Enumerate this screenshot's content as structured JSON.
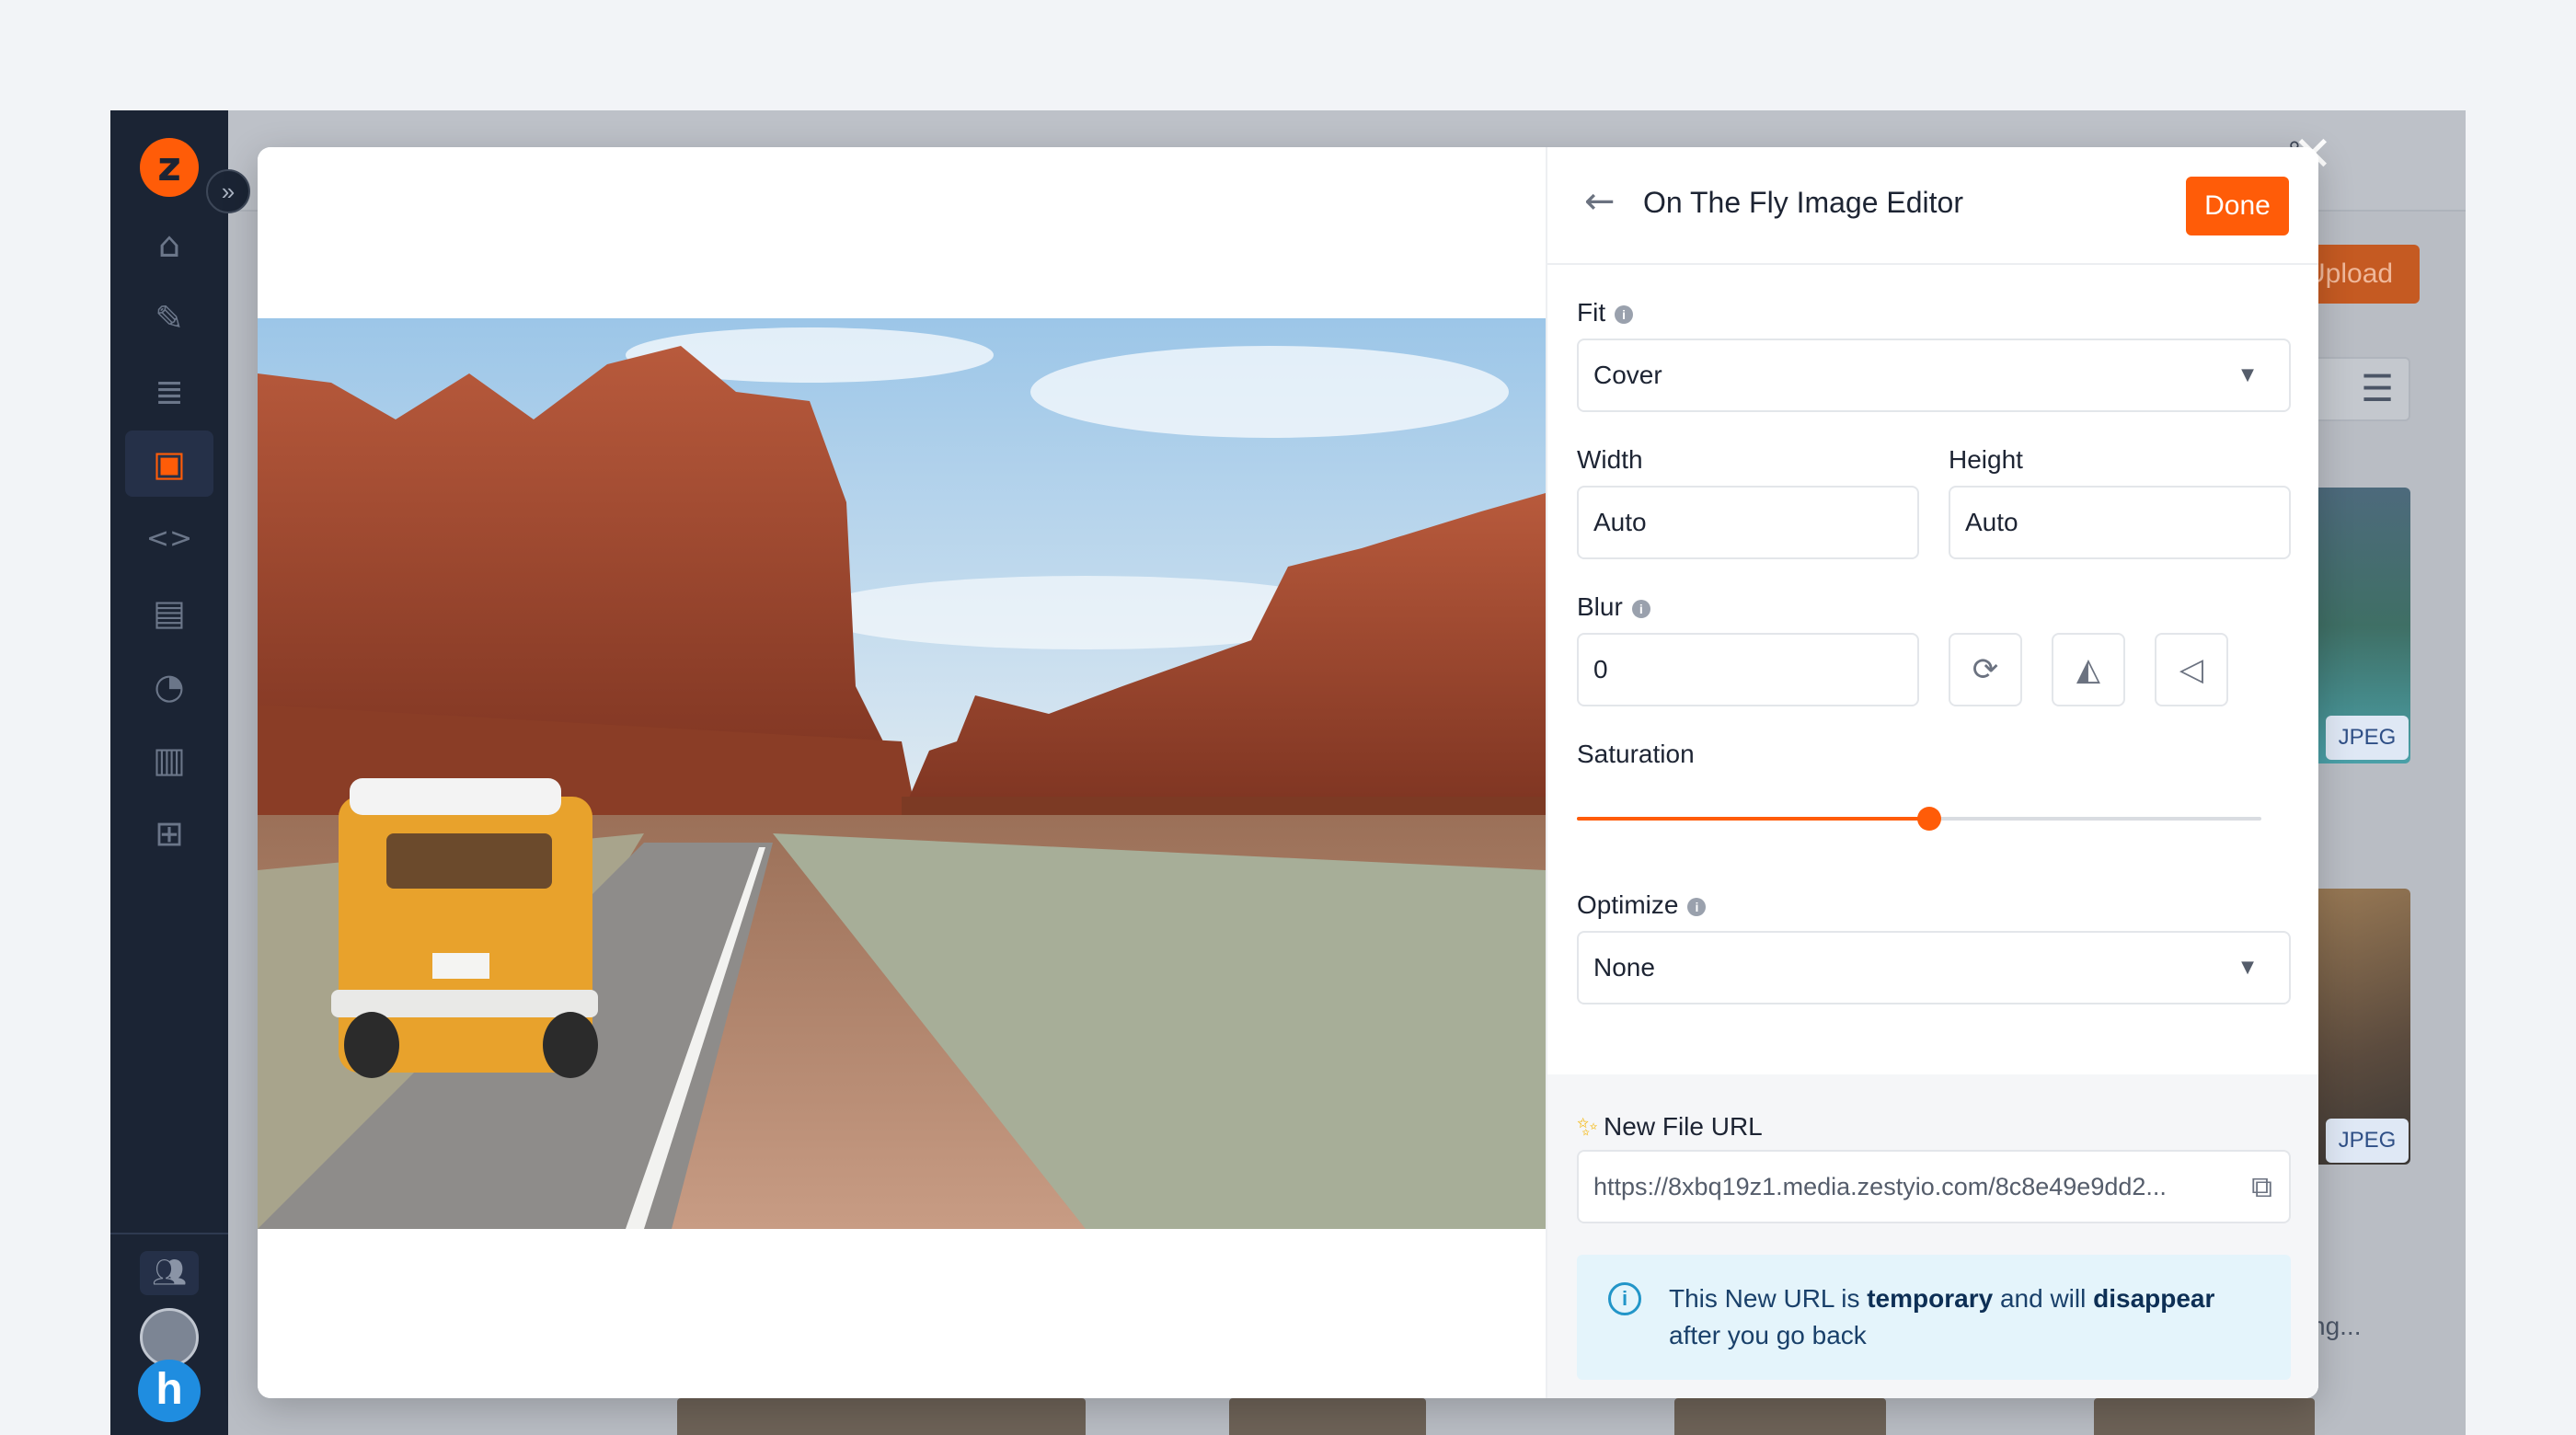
{
  "sidebar": {
    "logo_letter": "z",
    "nav": [
      "home-icon",
      "edit-icon",
      "database-icon",
      "media-icon",
      "code-icon",
      "reports-icon",
      "analytics-icon",
      "bar-chart-icon",
      "add-icon"
    ],
    "active_item": "media-icon"
  },
  "background": {
    "upload_label": "Upload",
    "jpeg_badge_1": "JPEG",
    "jpeg_badge_2": "JPEG",
    "truncated_filename": "ng..."
  },
  "editor": {
    "title": "On The Fly Image Editor",
    "done_label": "Done",
    "fit": {
      "label": "Fit",
      "value": "Cover"
    },
    "width": {
      "label": "Width",
      "value": "Auto"
    },
    "height": {
      "label": "Height",
      "value": "Auto"
    },
    "blur": {
      "label": "Blur",
      "value": "0"
    },
    "saturation": {
      "label": "Saturation",
      "level_fraction": 0.515
    },
    "optimize": {
      "label": "Optimize",
      "value": "None"
    },
    "new_url": {
      "label": "New File URL",
      "value": "https://8xbq19z1.media.zestyio.com/8c8e49e9dd2..."
    },
    "notice": {
      "part1": "This New URL is ",
      "bold1": "temporary",
      "part2": " and will ",
      "bold2": "disappear",
      "part3": " after you go back"
    }
  },
  "colors": {
    "accent": "#ff5c08",
    "sidebar_bg": "#1b2434",
    "notice_bg": "#e4f4fb"
  }
}
